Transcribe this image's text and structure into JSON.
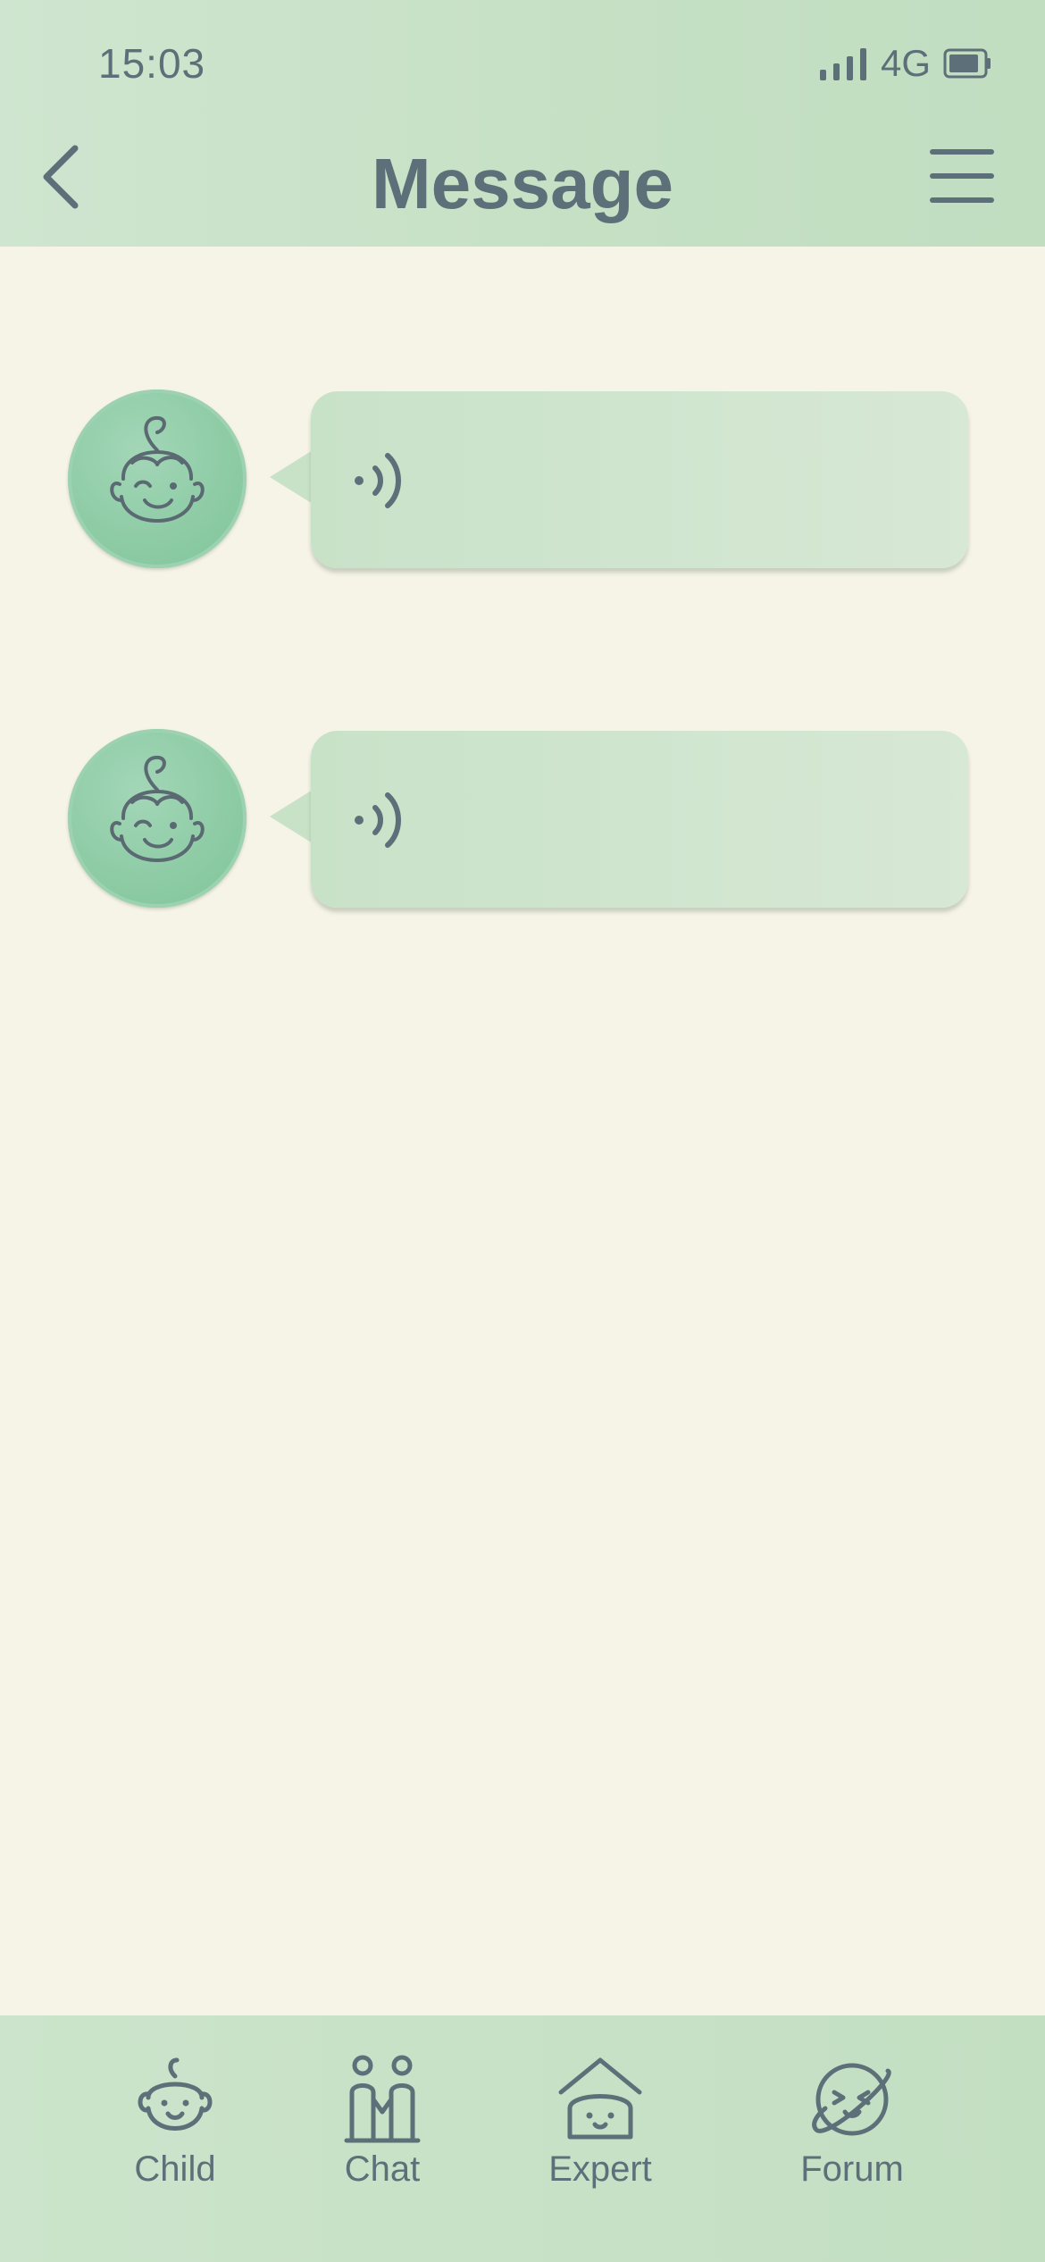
{
  "status_bar": {
    "time": "15:03",
    "network": "4G",
    "signal_icon": "signal-bars-icon",
    "battery_icon": "battery-icon"
  },
  "header": {
    "title": "Message",
    "back_icon": "chevron-left-icon",
    "menu_icon": "hamburger-menu-icon"
  },
  "messages": [
    {
      "type": "voice",
      "avatar": "baby-face-avatar",
      "icon": "voice-wave-icon"
    },
    {
      "type": "voice",
      "avatar": "baby-face-avatar",
      "icon": "voice-wave-icon"
    }
  ],
  "bottom_nav": {
    "items": [
      {
        "label": "Child",
        "icon": "baby-face-icon"
      },
      {
        "label": "Chat",
        "icon": "two-people-icon"
      },
      {
        "label": "Expert",
        "icon": "house-face-icon"
      },
      {
        "label": "Forum",
        "icon": "planet-face-icon"
      }
    ]
  },
  "colors": {
    "background": "#f6f3e7",
    "header": "#c5e0c4",
    "bubble": "#cfe5cd",
    "avatar": "#8ccba4",
    "text": "#5d7079"
  }
}
